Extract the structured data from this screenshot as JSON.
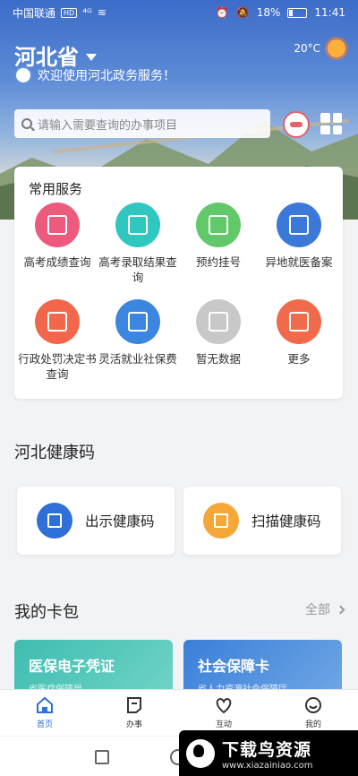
{
  "status_bar": {
    "carrier": "中国联通",
    "hd_badge": "HD",
    "signal": "⁴ᴳ",
    "battery": "18%",
    "time": "11:41"
  },
  "header": {
    "province": "河北省",
    "welcome": "欢迎使用河北政务服务！",
    "temperature": "20°C"
  },
  "search": {
    "placeholder": "请输入需要查询的办事项目"
  },
  "services": {
    "title": "常用服务",
    "items": [
      {
        "label": "高考成绩查询",
        "color": "#ec5b7d"
      },
      {
        "label": "高考录取结果查询",
        "color": "#2fc7bf"
      },
      {
        "label": "预约挂号",
        "color": "#62c96a"
      },
      {
        "label": "异地就医备案",
        "color": "#3b78d8"
      },
      {
        "label": "行政处罚决定书查询",
        "color": "#f2674b"
      },
      {
        "label": "灵活就业社保费",
        "color": "#3d86e0"
      },
      {
        "label": "暂无数据",
        "color": "#c8c8c8"
      },
      {
        "label": "更多",
        "color": "#f06a4c"
      }
    ]
  },
  "health": {
    "title": "河北健康码",
    "show_label": "出示健康码",
    "scan_label": "扫描健康码",
    "show_color": "#2e6fd8",
    "scan_color": "#f5a738"
  },
  "wallet": {
    "title": "我的卡包",
    "all_label": "全部",
    "cards": [
      {
        "name": "医保电子凭证",
        "org": "省医疗保障局",
        "color": "#3fbdb0"
      },
      {
        "name": "社会保障卡",
        "org": "省人力资源社会保障厅",
        "color": "#3a7fd8"
      }
    ]
  },
  "tabs": [
    {
      "label": "首页",
      "icon": "home-icon",
      "active": true
    },
    {
      "label": "办事",
      "icon": "document-icon"
    },
    {
      "label": "互动",
      "icon": "heart-icon"
    },
    {
      "label": "我的",
      "icon": "smile-icon"
    }
  ],
  "watermark": {
    "title": "下载鸟资源",
    "url": "www.xiazainiao.com"
  }
}
